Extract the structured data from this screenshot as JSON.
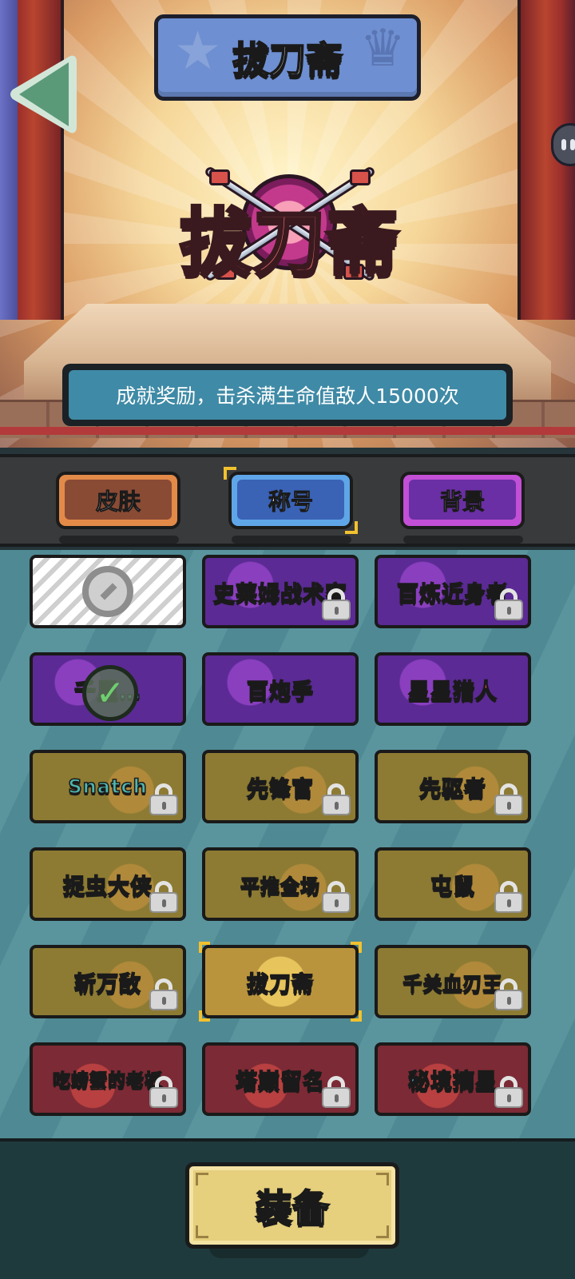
{
  "header": {
    "title": "拔刀斋",
    "back_icon": "left-triangle-arrow"
  },
  "showcase": {
    "emblem_text": "拔刀斋",
    "description": "成就奖励，击杀满生命值敌人15000次"
  },
  "tabs": [
    {
      "label": "皮肤",
      "active": false
    },
    {
      "label": "称号",
      "active": true
    },
    {
      "label": "背景",
      "active": false
    }
  ],
  "titles": [
    {
      "label": "",
      "theme": "none",
      "locked": false,
      "equipped": false,
      "selected": false
    },
    {
      "label": "史莱姆战术家",
      "theme": "purple",
      "locked": true,
      "equipped": false,
      "selected": false
    },
    {
      "label": "百炼近身者",
      "theme": "purple",
      "locked": true,
      "equipped": false,
      "selected": false
    },
    {
      "label": "千里…",
      "theme": "purple",
      "locked": false,
      "equipped": true,
      "selected": false
    },
    {
      "label": "百炮手",
      "theme": "purple",
      "locked": false,
      "equipped": false,
      "selected": false
    },
    {
      "label": "星星猎人",
      "theme": "purple",
      "locked": false,
      "equipped": false,
      "selected": false
    },
    {
      "label": "Snatch",
      "theme": "olive",
      "locked": true,
      "equipped": false,
      "selected": false
    },
    {
      "label": "先锋官",
      "theme": "olive",
      "locked": true,
      "equipped": false,
      "selected": false
    },
    {
      "label": "先驱者",
      "theme": "olive",
      "locked": true,
      "equipped": false,
      "selected": false
    },
    {
      "label": "捉虫大侠",
      "theme": "olive",
      "locked": true,
      "equipped": false,
      "selected": false
    },
    {
      "label": "平推全场",
      "theme": "olive",
      "locked": true,
      "equipped": false,
      "selected": false
    },
    {
      "label": "屯鼠",
      "theme": "olive",
      "locked": true,
      "equipped": false,
      "selected": false
    },
    {
      "label": "斩万敌",
      "theme": "olive",
      "locked": true,
      "equipped": false,
      "selected": false
    },
    {
      "label": "拔刀斋",
      "theme": "selected",
      "locked": false,
      "equipped": false,
      "selected": true
    },
    {
      "label": "千关血刃王",
      "theme": "olive",
      "locked": true,
      "equipped": false,
      "selected": false
    },
    {
      "label": "吃螃蟹的老板",
      "theme": "red",
      "locked": true,
      "equipped": false,
      "selected": false
    },
    {
      "label": "塔巅留名",
      "theme": "red",
      "locked": true,
      "equipped": false,
      "selected": false
    },
    {
      "label": "秘境摘星",
      "theme": "red",
      "locked": true,
      "equipped": false,
      "selected": false
    }
  ],
  "actions": {
    "equip_label": "装备"
  },
  "colors": {
    "tab_skin": "#e38a49",
    "tab_title": "#5fa6e8",
    "tab_background": "#c24fd6",
    "selection_corner": "#f2c12e",
    "equip_button": "#e6cf7d"
  }
}
